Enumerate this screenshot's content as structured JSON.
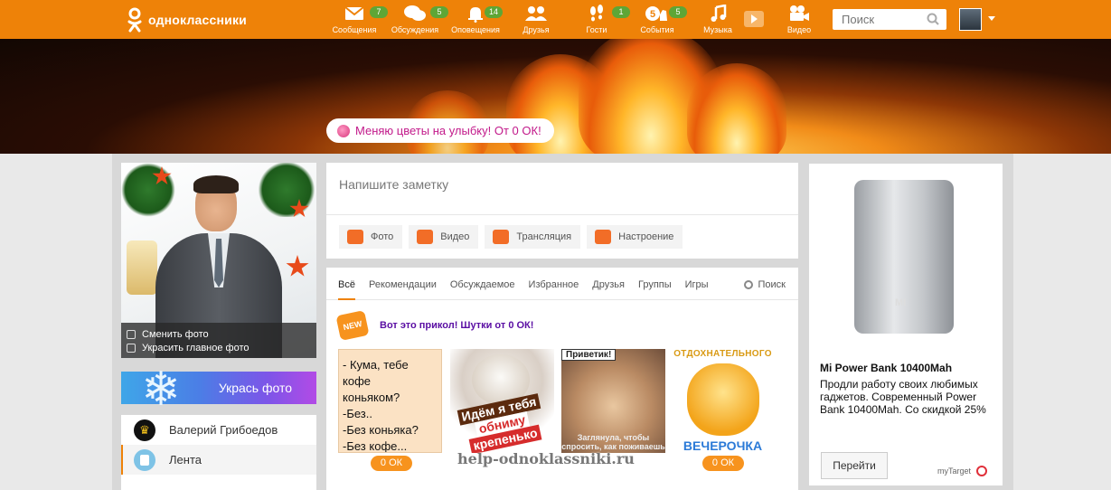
{
  "brand": {
    "logo_text": "одноклассники"
  },
  "nav": [
    {
      "label": "Сообщения",
      "badge": "7",
      "icon": "envelope-icon"
    },
    {
      "label": "Обсуждения",
      "badge": "5",
      "icon": "chat-bubbles-icon"
    },
    {
      "label": "Оповещения",
      "badge": "14",
      "icon": "bell-icon"
    },
    {
      "label": "Друзья",
      "badge": "",
      "icon": "friends-icon"
    },
    {
      "label": "Гости",
      "badge": "1",
      "icon": "footprints-icon"
    },
    {
      "label": "События",
      "badge": "5",
      "icon": "events-icon",
      "counter": "5"
    },
    {
      "label": "Музыка",
      "badge": "",
      "icon": "music-note-icon"
    },
    {
      "label": "Видео",
      "badge": "",
      "icon": "video-camera-icon"
    }
  ],
  "search": {
    "placeholder": "Поиск"
  },
  "cover": {
    "mood_text": "Меняю цветы на улыбку! От 0 ОК!"
  },
  "profile": {
    "change_photo": "Сменить фото",
    "decorate_main_photo": "Украсить главное фото",
    "decorate_button": "Укрась фото",
    "name": "Валерий Грибоедов",
    "feed": "Лента"
  },
  "note": {
    "placeholder": "Напишите заметку",
    "actions": [
      "Фото",
      "Видео",
      "Трансляция",
      "Настроение"
    ]
  },
  "feed": {
    "tabs": [
      "Всё",
      "Рекомендации",
      "Обсуждаемое",
      "Избранное",
      "Друзья",
      "Группы",
      "Игры"
    ],
    "search_label": "Поиск",
    "new_badge": "NEW",
    "post_title": "Вот это прикол! Шутки от 0 ОК!",
    "sticker1_lines": [
      "- Кума, тебе кофе",
      "коньяком?",
      "-Без..",
      "-Без коньяка?",
      "-Без кофе..."
    ],
    "sticker2_lines": [
      "Идём я тебя",
      "обниму",
      "крепенько"
    ],
    "sticker3_top": "Приветик!",
    "sticker3_bottom": "Заглянула, чтобы спросить, как поживаешь",
    "sticker4_top": "ОТДОХНАТЕЛЬНОГО",
    "sticker4_bottom": "ВЕЧЕРОЧКА",
    "price": "0 ОК"
  },
  "watermark": "help-odnoklassniki.ru",
  "ad": {
    "title": "Mi Power Bank 10400Mah",
    "text": "Продли работу своих любимых гаджетов. Современный Power Bank 10400Mah. Со скидкой 25%",
    "button": "Перейти",
    "source": "myTarget",
    "product_logo": "MI"
  },
  "colors": {
    "brand_orange": "#ee8208",
    "badge_green": "#5ea636",
    "post_title_purple": "#5a0ea3",
    "mood_pink": "#c2198a"
  }
}
